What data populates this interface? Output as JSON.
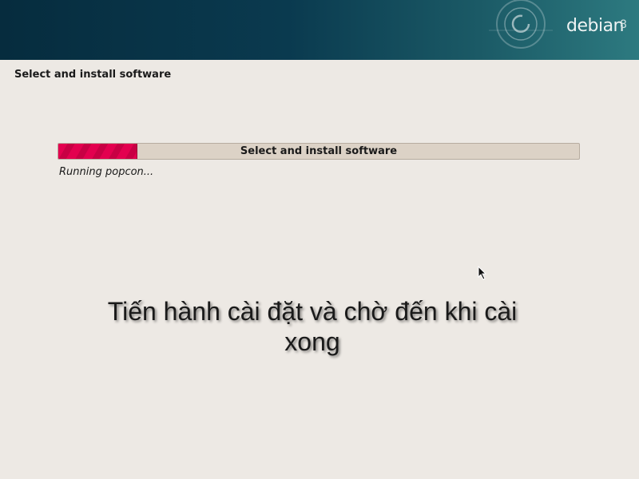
{
  "header": {
    "logo_text": "debian",
    "logo_version": "8",
    "colors": {
      "banner_dark": "#062c3e",
      "banner_light": "#2d7a80"
    }
  },
  "step": {
    "title": "Select and install software"
  },
  "progress": {
    "label": "Select and install software",
    "fraction": 0.15,
    "color": "#e3004f"
  },
  "status": {
    "text": "Running popcon..."
  },
  "caption": {
    "text": "Tiến hành cài đặt và chờ đến khi cài xong"
  },
  "icons": {
    "logo_swirl": "debian-swirl-icon",
    "cursor": "mouse-pointer-icon"
  }
}
